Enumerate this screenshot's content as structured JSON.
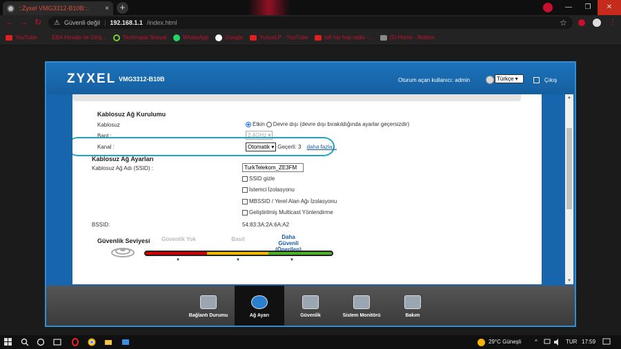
{
  "browser": {
    "tab_title": "::Zyxel VMG3312-B10B::.",
    "tab_close": "×",
    "newtab": "+",
    "win_min": "—",
    "win_max": "❐",
    "win_close": "✕",
    "back": "←",
    "forward": "→",
    "reload": "↻",
    "warn": "⚠",
    "security": "Güvenli değil",
    "separator": "|",
    "host": "192.168.1.1",
    "path": "/index.html",
    "star": "☆",
    "kebab": "⋮"
  },
  "bookmarks": [
    {
      "label": "YouTube",
      "icon": "youtube"
    },
    {
      "label": "EBA Hesabı ile Giriş...",
      "icon": "eba"
    },
    {
      "label": "Technopat Sosyal",
      "icon": "power"
    },
    {
      "label": "WhatsApp",
      "icon": "whatsapp"
    },
    {
      "label": "Google",
      "icon": "google"
    },
    {
      "label": "YunusLP - YouTube",
      "icon": "youtube"
    },
    {
      "label": "lofi hip hop radio -...",
      "icon": "youtube"
    },
    {
      "label": "(5) Home - Roblox",
      "icon": "roblox"
    }
  ],
  "router": {
    "brand": "ZYXEL",
    "model": "VMG3312-B10B",
    "login_text": "Oturum açan kullanıcı: admin",
    "language": "Türkçe ▾",
    "logout": "Çıkış"
  },
  "wireless": {
    "section_title": "Kablosuz Ağ Kurulumu",
    "wireless_label": "Kablosuz",
    "enabled_label": "Etkin",
    "disabled_label": "Devre dışı (devre dışı bırakıldığında ayarlar geçersizdir)",
    "band_label": "Bant :",
    "band_value": "2.4GHz ▾",
    "channel_label": "Kanal :",
    "channel_value": "Otomatik ▾",
    "current_channel": "Geçerli: 3",
    "more_link": "daha fazla..."
  },
  "network": {
    "section_title": "Kablosuz Ağ Ayarları",
    "ssid_label": "Kablosuz Ağ Adı (SSID) :",
    "ssid_value": "TurkTelekom_ZE3FM",
    "options": [
      "SSID gizle",
      "İstemci İzolasyonu",
      "MBSSID / Yerel Alan Ağı İzolasyonu",
      "Geliştirilmiş Multicast Yönlendirme"
    ],
    "bssid_label": "BSSID:",
    "bssid_value": "54:83:3A:2A:6A:A2"
  },
  "security": {
    "section_title": "Güvenlik Seviyesi",
    "levels": [
      "Güvenlik Yok",
      "Basit",
      "Daha Güvenli (Önerilen)"
    ]
  },
  "nav": [
    {
      "label": "Bağlantı Durumu",
      "icon": "connection-status-icon",
      "active": false
    },
    {
      "label": "Ağ Ayarı",
      "icon": "network-settings-icon",
      "active": true
    },
    {
      "label": "Güvenlik",
      "icon": "security-icon",
      "active": false
    },
    {
      "label": "Sistem Monitörü",
      "icon": "system-monitor-icon",
      "active": false
    },
    {
      "label": "Bakım",
      "icon": "maintenance-icon",
      "active": false
    }
  ],
  "taskbar": {
    "weather": "29°C  Güneşli",
    "lang": "TUR",
    "time": "17:59",
    "tray_up": "^"
  }
}
